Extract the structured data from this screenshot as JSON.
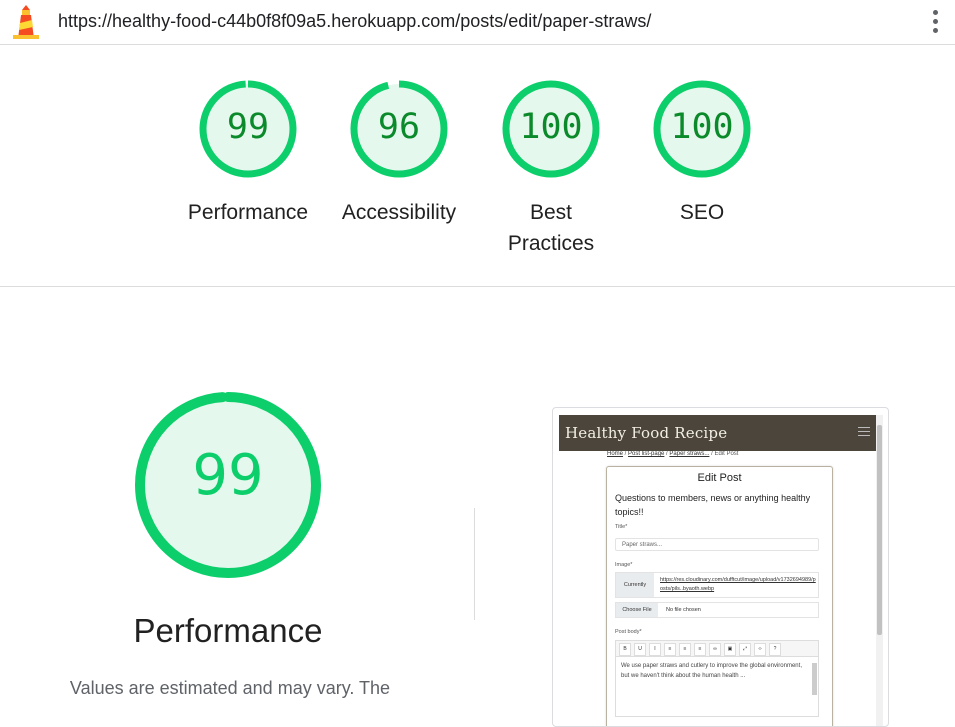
{
  "browser": {
    "url": "https://healthy-food-c44b0f8f09a5.herokuapp.com/posts/edit/paper-straws/",
    "logo_icon": "lighthouse-icon",
    "menu_icon": "kebab-menu-icon"
  },
  "colors": {
    "pass_ring": "#0cce6b",
    "pass_fill": "#e5f8ed",
    "pass_text": "#0a8a2a"
  },
  "gauges": [
    {
      "score": "99",
      "label": "Performance",
      "fraction": 0.99
    },
    {
      "score": "96",
      "label": "Accessibility",
      "fraction": 0.96
    },
    {
      "score": "100",
      "label": "Best Practices",
      "fraction": 1.0
    },
    {
      "score": "100",
      "label": "SEO",
      "fraction": 1.0
    }
  ],
  "main": {
    "score": "99",
    "fraction": 0.99,
    "title": "Performance",
    "note": "Values are estimated and may vary. The"
  },
  "preview": {
    "brand": "Healthy Food Recipe",
    "breadcrumbs": {
      "home": "Home",
      "list": "Post list-page",
      "post": "Paper straws...",
      "current": "Edit Post"
    },
    "card_title": "Edit Post",
    "intro": "Questions to members, news or anything healthy topics!!",
    "title_label": "Title*",
    "title_value": "Paper straws...",
    "image_label": "Image*",
    "currently": "Currently",
    "image_link": "https://res.cloudinary.com/dufftcut/image/upload/v1732694989/posts/pils..byaoth.webp",
    "choose_file": "Choose File",
    "no_file": "No file chosen",
    "body_label": "Post body*",
    "body_text": "We use paper straws and cutlery to improve the global environment, but we haven't think about the human health ..."
  }
}
